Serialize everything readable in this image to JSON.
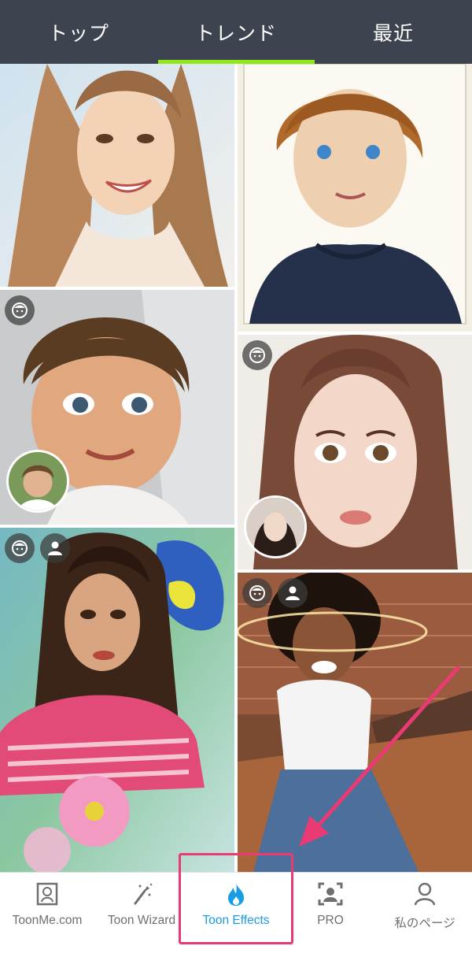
{
  "top_tabs": [
    {
      "label": "トップ"
    },
    {
      "label": "トレンド",
      "selected": true
    },
    {
      "label": "最近"
    }
  ],
  "colors": {
    "topbar": "#3d4450",
    "tab_indicator": "#8fe81a",
    "active_nav": "#1a9be6",
    "inactive_nav": "#6f6f6f",
    "annotation": "#ea3a74"
  },
  "tiles": [
    {
      "name": "sketch-girl-smiling",
      "badges": []
    },
    {
      "name": "sketch-boy-blue-eyes",
      "badges": []
    },
    {
      "name": "cartoon-girl-with-original",
      "badges": [
        "face-icon"
      ],
      "has_original_inset": true
    },
    {
      "name": "cartoon-woman-with-original",
      "badges": [
        "face-icon"
      ],
      "has_original_inset": true
    },
    {
      "name": "painted-woman-flowers",
      "badges": [
        "face-icon",
        "person-icon"
      ]
    },
    {
      "name": "cartoon-woman-halo",
      "badges": [
        "face-icon",
        "person-icon"
      ]
    }
  ],
  "bottom_nav": [
    {
      "label": "ToonMe.com",
      "icon": "portrait-frame-icon"
    },
    {
      "label": "Toon Wizard",
      "icon": "magic-wand-icon"
    },
    {
      "label": "Toon Effects",
      "icon": "flame-icon",
      "active": true
    },
    {
      "label": "PRO",
      "icon": "pro-face-frame-icon"
    },
    {
      "label": "私のページ",
      "icon": "user-icon"
    }
  ]
}
